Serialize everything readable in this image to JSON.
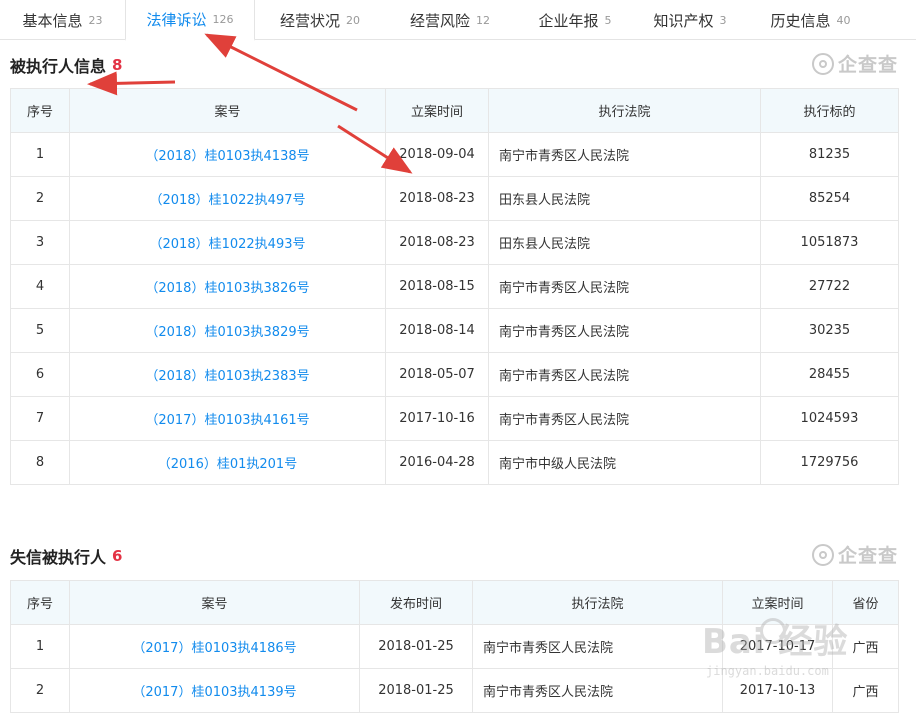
{
  "tabs": [
    {
      "label": "基本信息",
      "count": "23",
      "active": false
    },
    {
      "label": "法律诉讼",
      "count": "126",
      "active": true
    },
    {
      "label": "经营状况",
      "count": "20",
      "active": false
    },
    {
      "label": "经营风险",
      "count": "12",
      "active": false
    },
    {
      "label": "企业年报",
      "count": "5",
      "active": false
    },
    {
      "label": "知识产权",
      "count": "3",
      "active": false
    },
    {
      "label": "历史信息",
      "count": "40",
      "active": false
    }
  ],
  "brand": "企查查",
  "section1": {
    "title": "被执行人信息",
    "count": "8",
    "headers": [
      "序号",
      "案号",
      "立案时间",
      "执行法院",
      "执行标的"
    ],
    "rows": [
      [
        "1",
        "（2018）桂0103执4138号",
        "2018-09-04",
        "南宁市青秀区人民法院",
        "81235"
      ],
      [
        "2",
        "（2018）桂1022执497号",
        "2018-08-23",
        "田东县人民法院",
        "85254"
      ],
      [
        "3",
        "（2018）桂1022执493号",
        "2018-08-23",
        "田东县人民法院",
        "1051873"
      ],
      [
        "4",
        "（2018）桂0103执3826号",
        "2018-08-15",
        "南宁市青秀区人民法院",
        "27722"
      ],
      [
        "5",
        "（2018）桂0103执3829号",
        "2018-08-14",
        "南宁市青秀区人民法院",
        "30235"
      ],
      [
        "6",
        "（2018）桂0103执2383号",
        "2018-05-07",
        "南宁市青秀区人民法院",
        "28455"
      ],
      [
        "7",
        "（2017）桂0103执4161号",
        "2017-10-16",
        "南宁市青秀区人民法院",
        "1024593"
      ],
      [
        "8",
        "（2016）桂01执201号",
        "2016-04-28",
        "南宁市中级人民法院",
        "1729756"
      ]
    ]
  },
  "section2": {
    "title": "失信被执行人",
    "count": "6",
    "headers": [
      "序号",
      "案号",
      "发布时间",
      "执行法院",
      "立案时间",
      "省份"
    ],
    "rows": [
      [
        "1",
        "（2017）桂0103执4186号",
        "2018-01-25",
        "南宁市青秀区人民法院",
        "2017-10-17",
        "广西"
      ],
      [
        "2",
        "（2017）桂0103执4139号",
        "2018-01-25",
        "南宁市青秀区人民法院",
        "2017-10-13",
        "广西"
      ]
    ]
  },
  "watermark": {
    "main": "Bai  经验",
    "url": "jingyan.baidu.com"
  }
}
